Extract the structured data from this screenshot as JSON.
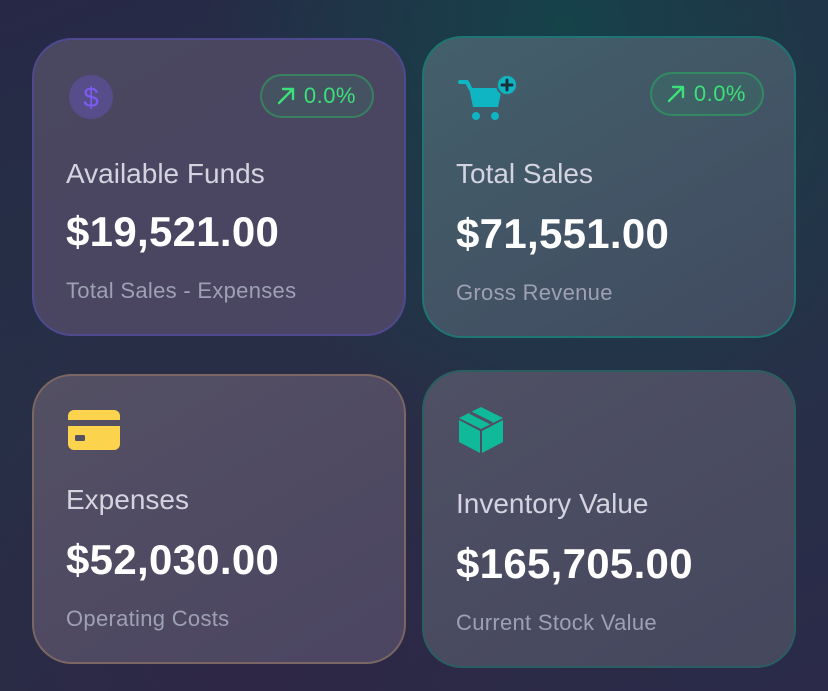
{
  "cards": [
    {
      "id": "available-funds",
      "title": "Available Funds",
      "amount": "$19,521.00",
      "subtitle": "Total Sales - Expenses",
      "icon": "dollar-sign-icon",
      "badge": {
        "icon": "trend-up-arrow-icon",
        "value": "0.0%"
      },
      "accent": "#6f4fd8"
    },
    {
      "id": "total-sales",
      "title": "Total Sales",
      "amount": "$71,551.00",
      "subtitle": "Gross Revenue",
      "icon": "cart-plus-icon",
      "badge": {
        "icon": "trend-up-arrow-icon",
        "value": "0.0%"
      },
      "accent": "#0fb5c3"
    },
    {
      "id": "expenses",
      "title": "Expenses",
      "amount": "$52,030.00",
      "subtitle": "Operating Costs",
      "icon": "credit-card-icon",
      "accent": "#fcd34d"
    },
    {
      "id": "inventory-value",
      "title": "Inventory Value",
      "amount": "$165,705.00",
      "subtitle": "Current Stock Value",
      "icon": "box-icon",
      "accent": "#10b999"
    }
  ],
  "colors": {
    "positive": "#3be07a",
    "title_text": "#d4d4e0",
    "amount_text": "#ffffff",
    "subtitle_text": "#9ea0b5"
  }
}
